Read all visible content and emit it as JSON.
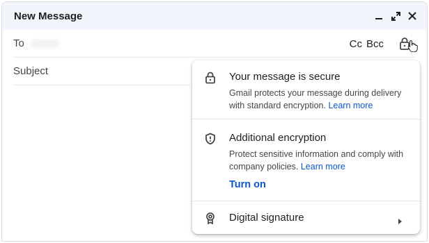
{
  "header": {
    "title": "New Message",
    "controls": [
      "minimize-icon",
      "expand-icon",
      "close-icon"
    ]
  },
  "fields": {
    "to_label": "To",
    "cc_label": "Cc",
    "bcc_label": "Bcc",
    "subject_placeholder": "Subject"
  },
  "security_menu": {
    "secure": {
      "title": "Your message is secure",
      "description": "Gmail protects your message during delivery with standard encryption.",
      "link": "Learn more"
    },
    "encryption": {
      "title": "Additional encryption",
      "description": "Protect sensitive information and comply with company policies.",
      "link": "Learn more",
      "action": "Turn on"
    },
    "signature": {
      "title": "Digital signature"
    }
  },
  "colors": {
    "header_bg": "#f2f6fc",
    "link": "#0b57d0",
    "text": "#1f1f1f",
    "secondary_text": "#444746"
  }
}
